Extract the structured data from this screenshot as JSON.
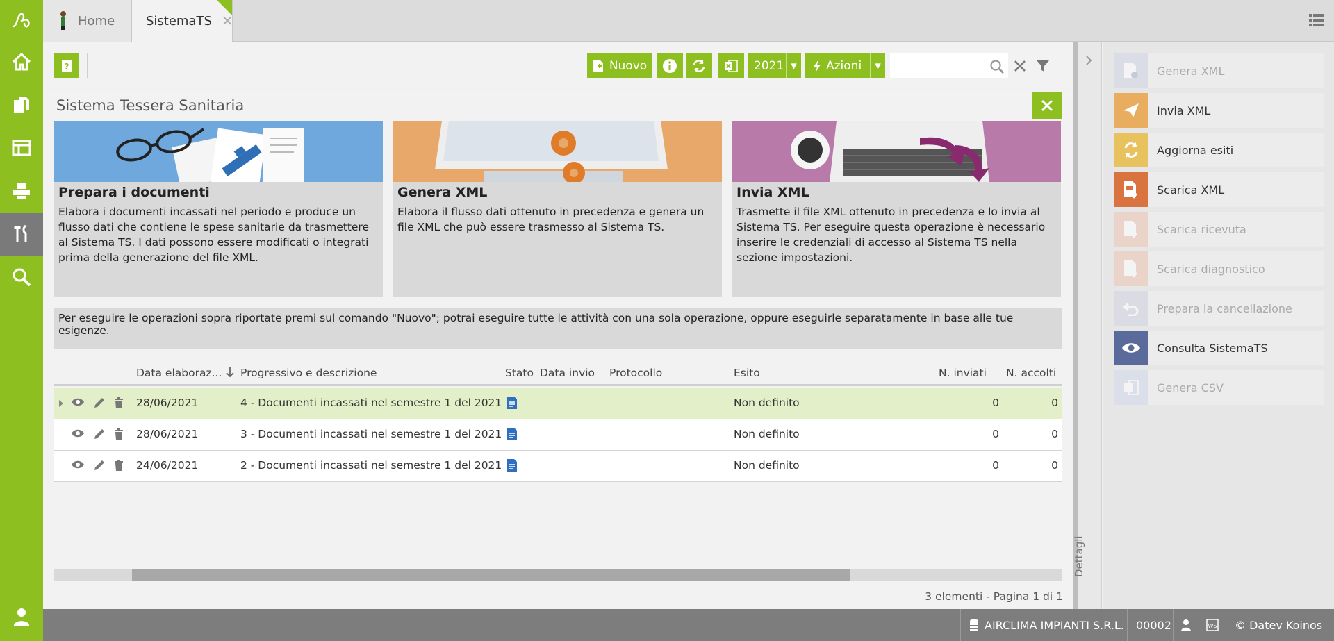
{
  "tabs": {
    "home": "Home",
    "active": "SistemaTS"
  },
  "toolbar": {
    "nuovo": "Nuovo",
    "year": "2021",
    "azioni": "Azioni",
    "search_placeholder": ""
  },
  "page": {
    "title": "Sistema Tessera Sanitaria"
  },
  "cards": [
    {
      "title": "Prepara i documenti",
      "desc": "Elabora i documenti incassati nel periodo e produce un flusso dati che contiene le spese sanitarie da trasmettere al Sistema TS. I dati possono essere modificati o integrati prima della generazione del file XML."
    },
    {
      "title": "Genera XML",
      "desc": "Elabora il flusso dati ottenuto in precedenza e genera un file XML che può essere trasmesso al Sistema TS."
    },
    {
      "title": "Invia XML",
      "desc": "Trasmette il file XML ottenuto in precedenza e lo invia al Sistema TS. Per eseguire questa operazione è necessario inserire le credenziali di accesso al Sistema TS nella sezione impostazioni."
    }
  ],
  "info": "Per eseguire le operazioni sopra riportate premi sul comando \"Nuovo\"; potrai eseguire tutte le attività con una sola operazione, oppure eseguirle separatamente in base alle tue esigenze.",
  "table": {
    "headers": {
      "data": "Data elaboraz...",
      "progressivo": "Progressivo e descrizione",
      "stato": "Stato",
      "data_invio": "Data invio",
      "protocollo": "Protocollo",
      "esito": "Esito",
      "inviati": "N. inviati",
      "accolti": "N. accolti"
    },
    "rows": [
      {
        "data": "28/06/2021",
        "desc": "4 - Documenti incassati nel semestre 1 del 2021",
        "esito": "Non definito",
        "inviati": "0",
        "accolti": "0"
      },
      {
        "data": "28/06/2021",
        "desc": "3 - Documenti incassati nel semestre 1 del 2021",
        "esito": "Non definito",
        "inviati": "0",
        "accolti": "0"
      },
      {
        "data": "24/06/2021",
        "desc": "2 - Documenti incassati nel semestre 1 del 2021",
        "esito": "Non definito",
        "inviati": "0",
        "accolti": "0"
      }
    ],
    "paging": "3 elementi - Pagina 1 di 1"
  },
  "details_label": "Dettagli",
  "side_actions": [
    {
      "label": "Genera XML",
      "enabled": false
    },
    {
      "label": "Invia XML",
      "enabled": true
    },
    {
      "label": "Aggiorna esiti",
      "enabled": true
    },
    {
      "label": "Scarica XML",
      "enabled": true
    },
    {
      "label": "Scarica ricevuta",
      "enabled": false
    },
    {
      "label": "Scarica diagnostico",
      "enabled": false
    },
    {
      "label": "Prepara la cancellazione",
      "enabled": false
    },
    {
      "label": "Consulta SistemaTS",
      "enabled": true
    },
    {
      "label": "Genera CSV",
      "enabled": false
    }
  ],
  "status": {
    "company": "AIRCLIMA IMPIANTI S.R.L.",
    "code": "00002",
    "copyright": "© Datev Koinos"
  },
  "colors": {
    "accent": "#8cbf1f",
    "blue_card": "#6fa8dc",
    "orange_card": "#e8a86a",
    "purple_card": "#b87aa8"
  }
}
